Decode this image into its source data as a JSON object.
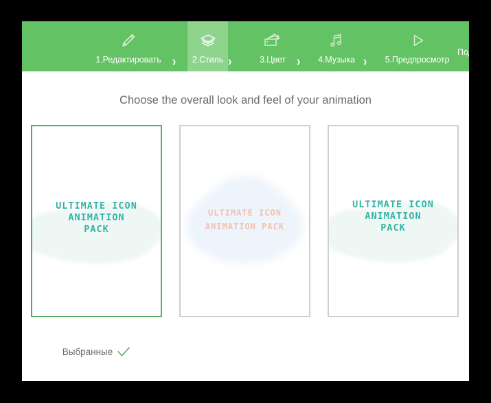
{
  "window": {
    "background_color": "#000000",
    "content_background": "#ffffff"
  },
  "header": {
    "background_color": "#63c264",
    "active_background_color": "#8ed48c",
    "text_color": "#ffffff",
    "steps": [
      {
        "label": "1.Редактировать",
        "icon": "pencil-icon",
        "active": false
      },
      {
        "label": "2.Стиль",
        "icon": "layers-icon",
        "active": true
      },
      {
        "label": "3.Цвет",
        "icon": "color-palette-icon",
        "active": false
      },
      {
        "label": "4.Музыка",
        "icon": "music-note-icon",
        "active": false
      },
      {
        "label": "5.Предпросмотр",
        "icon": "play-icon",
        "active": false
      }
    ],
    "separator_glyph": "›",
    "submit_label": "Под"
  },
  "main": {
    "subtitle": "Choose the overall look and feel of your animation",
    "selected_label": "Выбранные",
    "check_color": "#5faa63",
    "selected_border_color": "#5faa63",
    "card_border_color": "#cfcfcf",
    "cards": [
      {
        "style": "teal",
        "selected": true,
        "text_color": "#33b3a6",
        "lines": [
          "ULTIMATE ICON",
          "ANIMATION",
          "PACK"
        ]
      },
      {
        "style": "peach",
        "selected": false,
        "text_color": "#f3b9a4",
        "lines": [
          "ULTIMATE ICON",
          "ANIMATION PACK"
        ]
      },
      {
        "style": "teal",
        "selected": false,
        "text_color": "#33b3a6",
        "lines": [
          "ULTIMATE ICON",
          "ANIMATION",
          "PACK"
        ]
      }
    ]
  }
}
